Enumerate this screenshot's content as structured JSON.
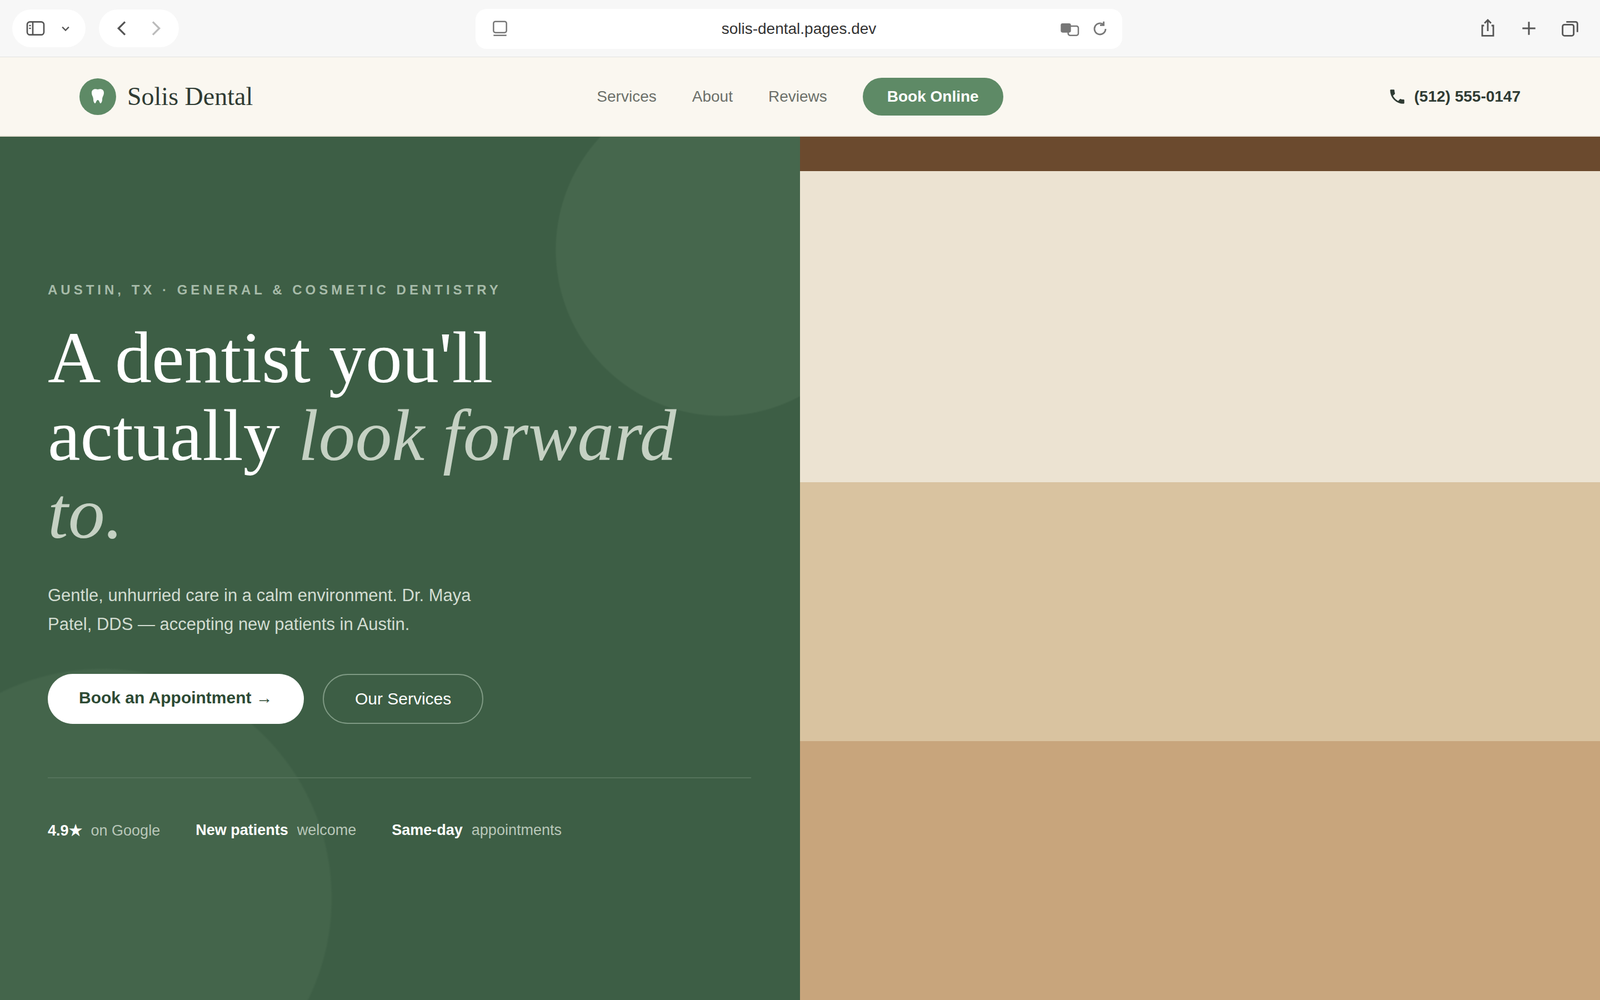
{
  "browser": {
    "url": "solis-dental.pages.dev"
  },
  "header": {
    "logo": "Solis Dental",
    "nav": [
      "Services",
      "About",
      "Reviews"
    ],
    "cta": "Book Online",
    "phone": "(512) 555-0147"
  },
  "hero": {
    "eyebrow": "AUSTIN, TX · GENERAL & COSMETIC DENTISTRY",
    "headline": {
      "plain": "A dentist you'll actually",
      "accent": "look forward to."
    },
    "subtext": "Gentle, unhurried care in a calm environment. Dr. Maya Patel, DDS — accepting new patients in Austin.",
    "buttons": [
      {
        "label": "Book an Appointment →",
        "kind": "primary"
      },
      {
        "label": "Our Services",
        "kind": "secondary"
      }
    ],
    "stats": [
      {
        "value": "4.9★",
        "label": "on Google"
      },
      {
        "value": "New patients",
        "label": "welcome"
      },
      {
        "value": "Same-day",
        "label": "appointments"
      }
    ]
  }
}
